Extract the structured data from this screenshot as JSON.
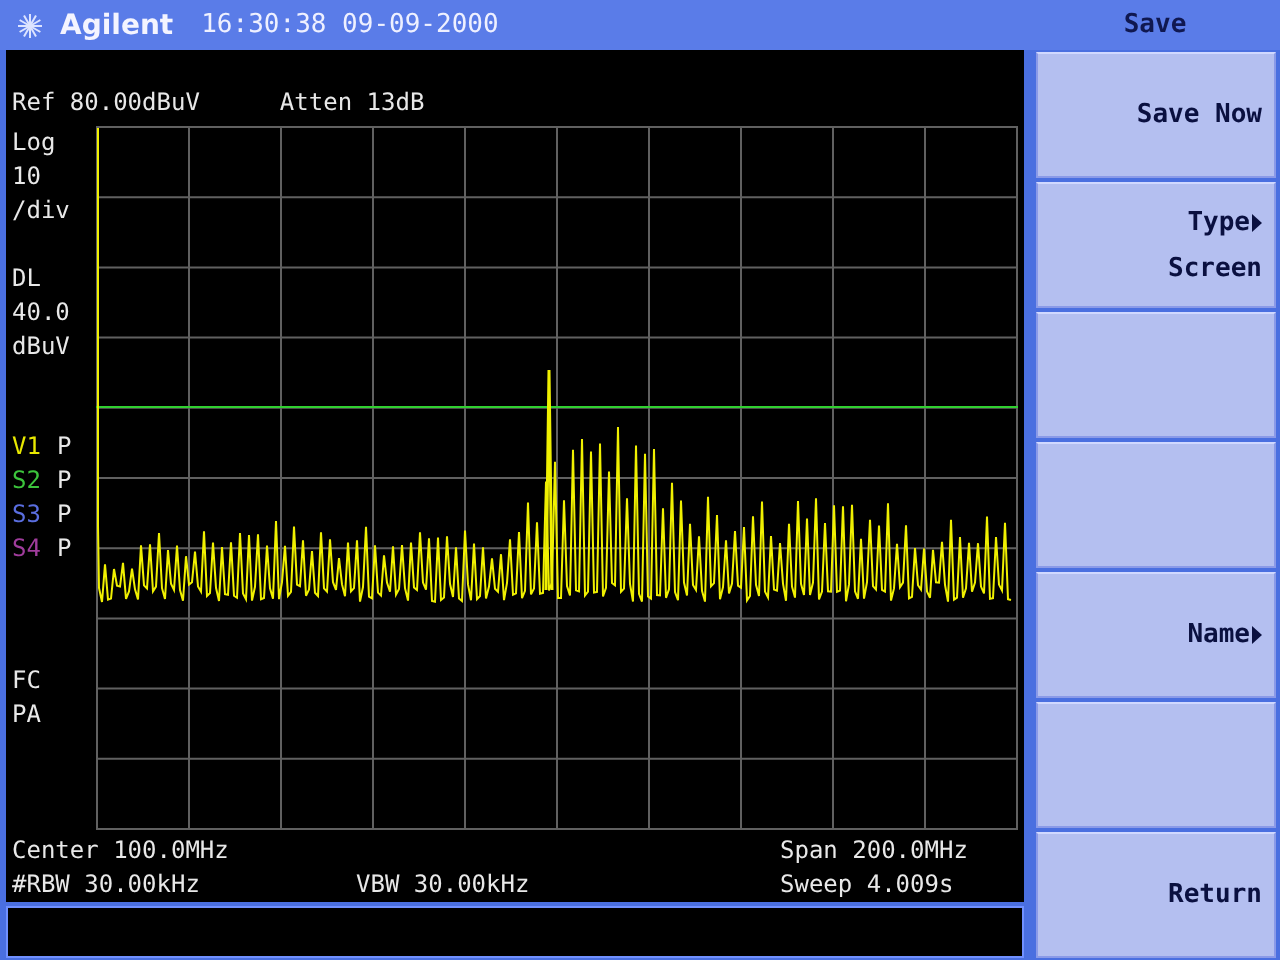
{
  "header": {
    "logo": "Agilent",
    "datetime": "16:30:38 09-09-2000"
  },
  "display": {
    "ref": "Ref 80.00dBuV",
    "atten": "Atten 13dB",
    "scale": [
      "Log",
      "10",
      "/div"
    ],
    "display_line": [
      "DL",
      "40.0",
      "dBuV"
    ],
    "traces": [
      {
        "label": "V1",
        "mode": "P",
        "color": "#e8e800"
      },
      {
        "label": "S2",
        "mode": "P",
        "color": "#3cc43c"
      },
      {
        "label": "S3",
        "mode": "P",
        "color": "#5a6ee0"
      },
      {
        "label": "S4",
        "mode": "P",
        "color": "#a03c9c"
      }
    ],
    "flags": [
      "FC",
      "PA"
    ],
    "center": "Center 100.0MHz",
    "span": "Span 200.0MHz",
    "rbw": "#RBW 30.00kHz",
    "vbw": "VBW 30.00kHz",
    "sweep": "Sweep 4.009s"
  },
  "menu": {
    "title": "Save",
    "softkeys": [
      {
        "kind": "action",
        "label": "Save Now"
      },
      {
        "kind": "submenu",
        "label": "Type",
        "value": "Screen"
      },
      {
        "kind": "blank"
      },
      {
        "kind": "blank"
      },
      {
        "kind": "submenu",
        "label": "Name"
      },
      {
        "kind": "blank"
      },
      {
        "kind": "action",
        "label": "Return"
      }
    ]
  }
}
